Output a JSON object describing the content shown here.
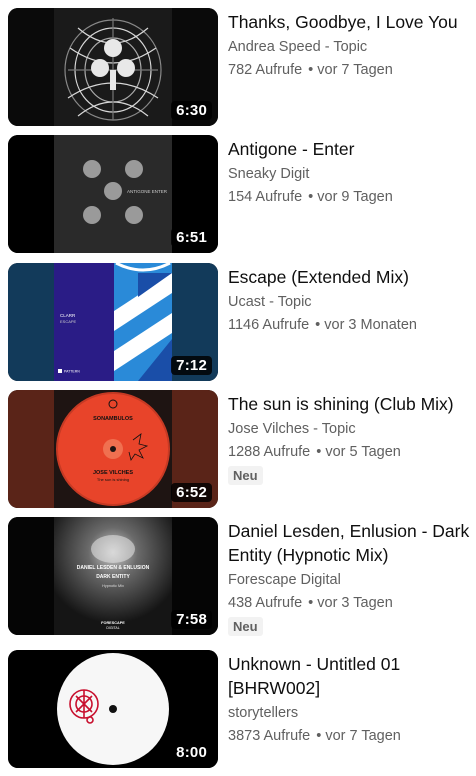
{
  "videos": [
    {
      "title": "Thanks, Goodbye, I Love You",
      "channel": "Andrea Speed - Topic",
      "views": "782 Aufrufe",
      "age": "vor 7 Tagen",
      "duration": "6:30",
      "badge": null
    },
    {
      "title": "Antigone - Enter",
      "channel": "Sneaky Digit",
      "views": "154 Aufrufe",
      "age": "vor 9 Tagen",
      "duration": "6:51",
      "badge": null,
      "thumb_text": "ANTIGONE ENTER"
    },
    {
      "title": "Escape (Extended Mix)",
      "channel": "Ucast - Topic",
      "views": "1146 Aufrufe",
      "age": "vor 3 Monaten",
      "duration": "7:12",
      "badge": null,
      "thumb_text_1": "CLARR",
      "thumb_text_2": "ESCAPE",
      "thumb_text_3": "PATTERN"
    },
    {
      "title": "The sun is shining (Club Mix)",
      "channel": "Jose Vilches - Topic",
      "views": "1288 Aufrufe",
      "age": "vor 5 Tagen",
      "duration": "6:52",
      "badge": "Neu",
      "thumb_text_1": "SONAMBULOS",
      "thumb_text_2": "JOSE VILCHES",
      "thumb_text_3": "The sun is shining"
    },
    {
      "title": "Daniel Lesden, Enlusion - Dark Entity (Hypnotic Mix)",
      "channel": "Forescape Digital",
      "views": "438 Aufrufe",
      "age": "vor 3 Tagen",
      "duration": "7:58",
      "badge": "Neu",
      "thumb_text_1": "DANIEL LESDEN & ENLUSION",
      "thumb_text_2": "DARK ENTITY",
      "thumb_text_3": "Hypnotic Mix",
      "thumb_text_4": "FORESCAPE",
      "thumb_text_5": "DIGITAL"
    },
    {
      "title": "Unknown - Untitled 01 [BHRW002]",
      "channel": "storytellers",
      "views": "3873 Aufrufe",
      "age": "vor 7 Tagen",
      "duration": "8:00",
      "badge": null
    }
  ],
  "separator": "•"
}
